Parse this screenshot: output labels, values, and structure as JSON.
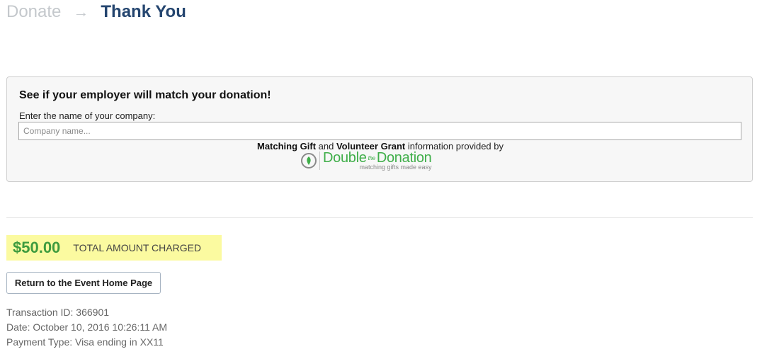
{
  "steps": {
    "donate": "Donate",
    "arrow": "→",
    "thank_you": "Thank You"
  },
  "match": {
    "heading": "See if your employer will match your donation!",
    "label": "Enter the name of your company:",
    "placeholder": "Company name...",
    "provided_bold_1": "Matching Gift",
    "provided_and": " and ",
    "provided_bold_2": "Volunteer Grant",
    "provided_rest": " information provided by",
    "logo_double": "Double",
    "logo_the": "the",
    "logo_donation": "Donation",
    "logo_tagline": "matching gifts made easy"
  },
  "total": {
    "amount": "$50.00",
    "label": "TOTAL AMOUNT CHARGED"
  },
  "return_button_label": "Return to the Event Home Page",
  "details": {
    "transaction": "Transaction ID: 366901",
    "date": "Date: October 10, 2016 10:26:11 AM",
    "payment": "Payment Type: Visa ending in XX11"
  },
  "colors": {
    "step_active": "#24456f",
    "step_inactive": "#c4c8cc",
    "total_highlight": "#fbfaa0",
    "total_amount": "#3e9b3e",
    "logo_green": "#3fae49"
  },
  "icons": {
    "step_arrow": "arrow-right-icon",
    "logo_mark": "double-the-donation-logo-icon"
  }
}
